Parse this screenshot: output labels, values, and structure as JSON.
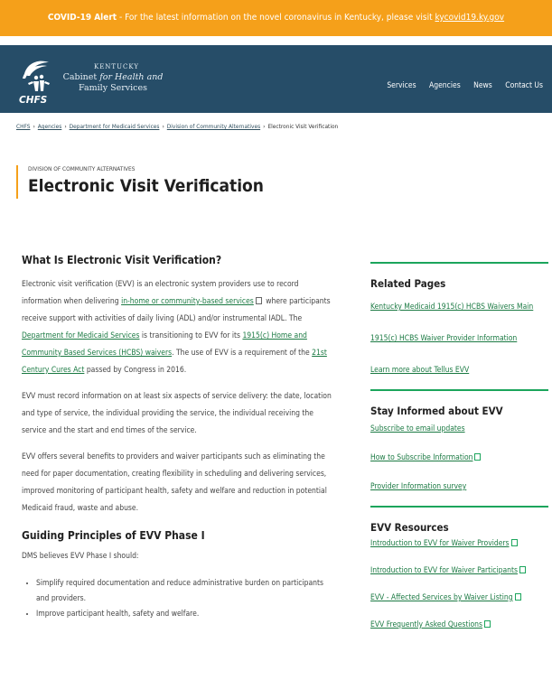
{
  "alert": {
    "title": "COVID-19 Alert",
    "message": " - For the latest information on the novel coronavirus in Kentucky, please visit ",
    "link": "kycovid19.ky.gov"
  },
  "header": {
    "state": "KENTUCKY",
    "agency_line1": "Cabinet ",
    "agency_italic": "for Health and",
    "agency_line2": "Family Services",
    "logo_text": "CHFS",
    "nav": [
      "Services",
      "Agencies",
      "News",
      "Contact Us"
    ]
  },
  "breadcrumb": [
    "CHFS",
    "Agencies",
    "Department for Medicaid Services",
    "Division of Community Alternatives",
    "Electronic Visit Verification"
  ],
  "page": {
    "kicker": "DIVISION OF COMMUNITY ALTERNATIVES",
    "title": "Electronic Visit Verification"
  },
  "content": {
    "heading1": "What Is Electronic Visit Verification?",
    "p1": {
      "a": "Electronic visit verification (EVV) is an electronic system providers use to record information when delivering ",
      "link1": "in-home or community-based services",
      "b": " where participants receive support with activities of daily living (ADL) and/or instrumental IADL. The ",
      "link2": "Department for Medicaid Services",
      "c": " is transitioning to EVV for its ",
      "link3": "1915(c) Home and Community Based Services (HCBS) waivers",
      "d": ". The use of EVV is  a requirement of the ",
      "link4": "21st Century Cures Act",
      "e": " passed by Congress in 2016."
    },
    "p2": "EVV must record information on at least six aspects of service delivery: the date, location and type of service, the individual providing the service, the individual receiving the service and the start and end times of the service.",
    "p3": "EVV offers several benefits to providers and waiver participants such as eliminating the need for paper documentation, creating flexibility in scheduling and delivering services, improved monitoring of participant health, safety and welfare and reduction in potential Medicaid fraud, waste and abuse.",
    "heading2": "Guiding Principles of EVV Phase I",
    "p4": "DMS believes EVV Phase I should:",
    "bullets": [
      "Simplify required documentation and reduce administrative burden on participants and providers.",
      "Improve participant health, safety and welfare."
    ]
  },
  "sidebar": {
    "related_title": "Related Pages",
    "related": [
      {
        "label": "Kentucky Medicaid 1915(c) HCBS Waivers Main",
        "pdf": false
      },
      {
        "label": "1915(c) HCBS Waiver Provider Information",
        "pdf": false
      },
      {
        "label": "Learn more about Tellus EVV",
        "pdf": false
      }
    ],
    "informed_title": "Stay Informed about EVV",
    "informed": [
      {
        "label": "Subscribe to email updates",
        "pdf": false
      },
      {
        "label": "How to Subscribe Information",
        "pdf": true
      },
      {
        "label": "Provider Information survey ",
        "pdf": false
      }
    ],
    "resources_title": "EVV Resources",
    "resources": [
      {
        "label": "Introduction to EVV for Waiver Providers",
        "pdf": true
      },
      {
        "label": "Introduction to EVV for Waiver Participants",
        "pdf": true
      },
      {
        "label": "EVV - Affected Services by Waiver Listing",
        "pdf": true
      },
      {
        "label": "EVV Frequently Asked Questions",
        "pdf": true
      }
    ]
  },
  "colors": {
    "alert": "#f5a01a",
    "header": "#264d68",
    "link": "#1b7a43",
    "rule": "#1ba55c"
  }
}
